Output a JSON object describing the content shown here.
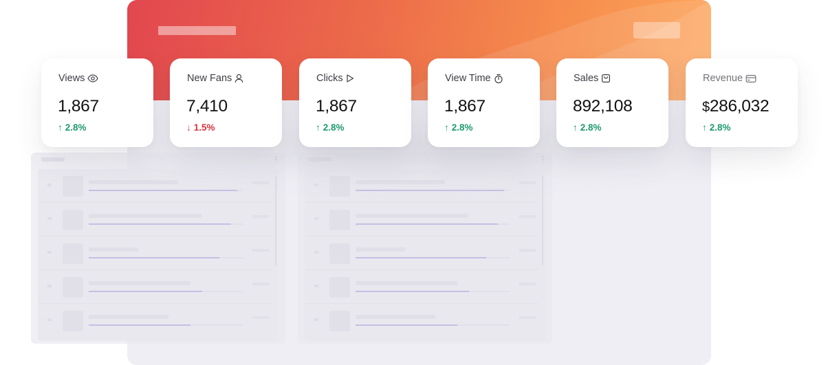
{
  "colors": {
    "header_start": "#e2474f",
    "header_end": "#fda55a",
    "positive": "#1f9a6b",
    "negative": "#d8333d",
    "text": "#111114"
  },
  "stats": [
    {
      "label": "Views",
      "icon": "eye-icon",
      "value": "1,867",
      "arrow": "↑",
      "change": "2.8%",
      "trend": "up"
    },
    {
      "label": "New Fans",
      "icon": "user-icon",
      "value": "7,410",
      "arrow": "↓",
      "change": "1.5%",
      "trend": "down"
    },
    {
      "label": "Clicks",
      "icon": "play-icon",
      "value": "1,867",
      "arrow": "↑",
      "change": "2.8%",
      "trend": "up"
    },
    {
      "label": "View Time",
      "icon": "stopwatch-icon",
      "value": "1,867",
      "arrow": "↑",
      "change": "2.8%",
      "trend": "up"
    },
    {
      "label": "Sales",
      "icon": "shopping-bag-icon",
      "value": "892,108",
      "arrow": "↑",
      "change": "2.8%",
      "trend": "up"
    },
    {
      "label": "Revenue",
      "icon": "credit-card-icon",
      "currency": "$",
      "value": "286,032",
      "arrow": "↑",
      "change": "2.8%",
      "trend": "up"
    }
  ]
}
